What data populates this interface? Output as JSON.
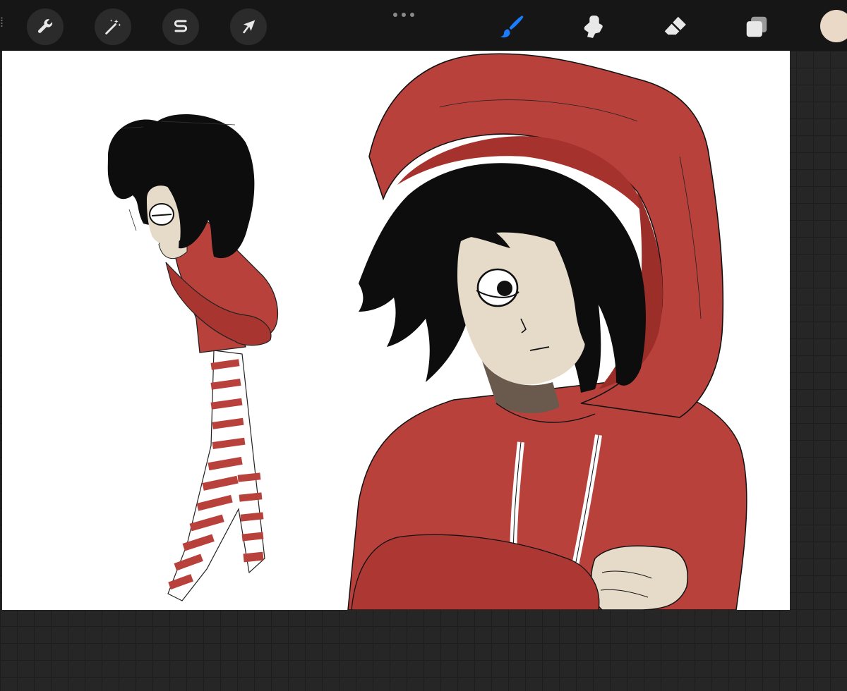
{
  "app": "Procreate",
  "toolbar": {
    "left_tools": [
      {
        "name": "actions",
        "icon": "wrench-icon"
      },
      {
        "name": "adjustments",
        "icon": "magic-wand-icon"
      },
      {
        "name": "selection",
        "icon": "selection-s-icon"
      },
      {
        "name": "transform",
        "icon": "arrow-cursor-icon"
      }
    ],
    "more_icon": "ellipsis-icon",
    "right_tools": [
      {
        "name": "brush",
        "icon": "brush-icon",
        "active": true
      },
      {
        "name": "smudge",
        "icon": "smudge-icon"
      },
      {
        "name": "eraser",
        "icon": "eraser-icon"
      },
      {
        "name": "layers",
        "icon": "layers-icon"
      }
    ],
    "current_color": "#ead9c6",
    "active_color": "#1a7cff"
  },
  "canvas": {
    "background": "#ffffff",
    "palette": {
      "hoodie_red": "#b8413c",
      "hair_black": "#0d0d0d",
      "skin": "#e6dbc9",
      "stripe_white": "#ffffff"
    }
  }
}
